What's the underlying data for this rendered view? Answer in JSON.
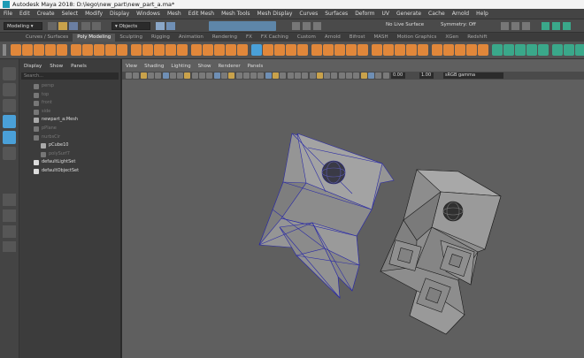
{
  "window": {
    "title": "Autodesk Maya 2018: D:\\lego\\new_part\\new_part_a.ma*"
  },
  "menubar": {
    "items": [
      "File",
      "Edit",
      "Create",
      "Select",
      "Modify",
      "Display",
      "Windows",
      "Mesh",
      "Edit Mesh",
      "Mesh Tools",
      "Mesh Display",
      "Curves",
      "Surfaces",
      "Deform",
      "UV",
      "Generate",
      "Cache",
      "Arnold",
      "Help"
    ]
  },
  "statusline": {
    "menuset": "Modeling",
    "selection_mode": "Objects",
    "live_surface": "No Live Surface",
    "symmetry": "Symmetry: Off"
  },
  "shelf": {
    "tabs": [
      "Curves / Surfaces",
      "Poly Modeling",
      "Sculpting",
      "Rigging",
      "Animation",
      "Rendering",
      "FX",
      "FX Caching",
      "Custom",
      "Arnold",
      "Bifrost",
      "MASH",
      "Motion Graphics",
      "XGen",
      "Redshift"
    ],
    "active_tab": "Poly Modeling",
    "colors": {
      "orange": "#e0873a",
      "green": "#3aa88a",
      "blue": "#4aa0d8"
    }
  },
  "outliner": {
    "menu": [
      "Display",
      "Show",
      "Panels"
    ],
    "search_placeholder": "Search...",
    "items": [
      {
        "label": "persp",
        "dim": true,
        "icon": "camera-icon"
      },
      {
        "label": "top",
        "dim": true,
        "icon": "camera-icon"
      },
      {
        "label": "front",
        "dim": true,
        "icon": "camera-icon"
      },
      {
        "label": "side",
        "dim": true,
        "icon": "camera-icon"
      },
      {
        "label": "newpart_a:Mesh",
        "dim": false,
        "icon": "mesh-icon"
      },
      {
        "label": "pPlane",
        "dim": true,
        "icon": "mesh-icon"
      },
      {
        "label": "nurbsCir",
        "dim": true,
        "icon": "curve-icon"
      },
      {
        "label": "pCube10",
        "dim": false,
        "icon": "mesh-icon"
      },
      {
        "label": "polySurf7",
        "dim": true,
        "icon": "mesh-icon"
      },
      {
        "label": "defaultLightSet",
        "dim": false,
        "icon": "set-icon"
      },
      {
        "label": "defaultObjectSet",
        "dim": false,
        "icon": "set-icon"
      }
    ]
  },
  "viewport": {
    "menu": [
      "View",
      "Shading",
      "Lighting",
      "Show",
      "Renderer",
      "Panels"
    ],
    "exposure": "0.00",
    "gamma": "1.00",
    "color_space": "sRGB gamma",
    "wire_color": "#2a2aa6"
  }
}
